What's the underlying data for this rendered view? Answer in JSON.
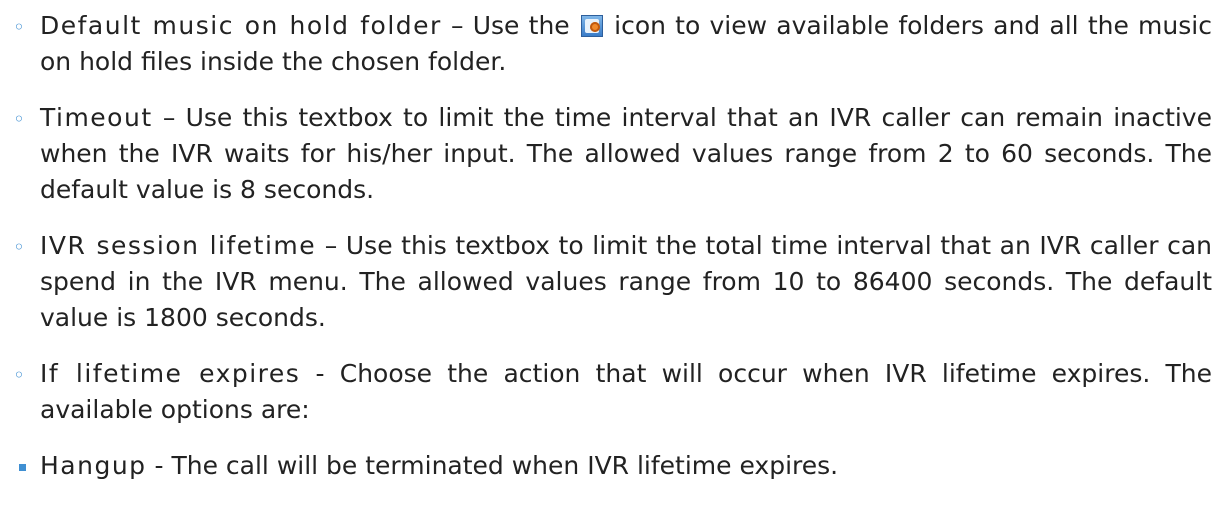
{
  "items": [
    {
      "term": "Default music on hold folder",
      "sep": " – ",
      "text_before_icon": "Use the",
      "icon": "folder-browse-icon",
      "text_after_icon": "icon to view available folders and all the music on hold files inside the chosen folder."
    },
    {
      "term": "Timeout",
      "sep": " – ",
      "text": "Use this textbox to limit the time interval that an IVR caller can remain inactive when the IVR waits for his/her input. The allowed values range from 2 to 60 seconds. The default value is 8 seconds."
    },
    {
      "term": "IVR session lifetime",
      "sep": " – ",
      "text": "Use this textbox to limit the total time interval that an IVR caller can spend in the IVR menu. The allowed values range from 10 to 86400 seconds. The default value is 1800 seconds."
    },
    {
      "term": "If lifetime expires",
      "sep": " - ",
      "text": "Choose the action that will occur when IVR lifetime expires. The available options are:"
    }
  ],
  "subitems": [
    {
      "term": "Hangup",
      "sep": " - ",
      "text": "The call will be terminated when IVR lifetime expires."
    }
  ],
  "colors": {
    "bullet": "#3f8fd2",
    "text": "#222222"
  }
}
